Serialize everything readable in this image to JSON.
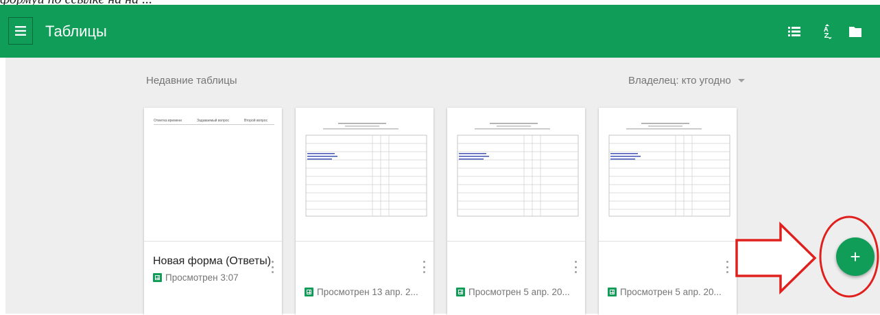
{
  "caption_text": "формуй по ссылке на на ...",
  "app": {
    "title": "Таблицы",
    "menu_icon": "hamburger-menu-icon",
    "actions": [
      "list-view-icon",
      "sort-az-icon",
      "folder-icon"
    ],
    "accent_color": "#0f9d58"
  },
  "recent": {
    "section_title": "Недавние таблицы",
    "owner_filter": "Владелец: кто угодно"
  },
  "cards": [
    {
      "title": "Новая форма (Ответы)",
      "meta": "Просмотрен 3:07",
      "thumb_headers": [
        "Отметка времени",
        "Задаваемый вопрос",
        "Второй вопрос"
      ]
    },
    {
      "title": "",
      "meta": "Просмотрен 13 апр. 2..."
    },
    {
      "title": "",
      "meta": "Просмотрен 5 апр. 20..."
    },
    {
      "title": "",
      "meta": "Просмотрен 5 апр. 20..."
    }
  ],
  "fab": {
    "label": "+",
    "annotation_color": "#e0201c"
  }
}
